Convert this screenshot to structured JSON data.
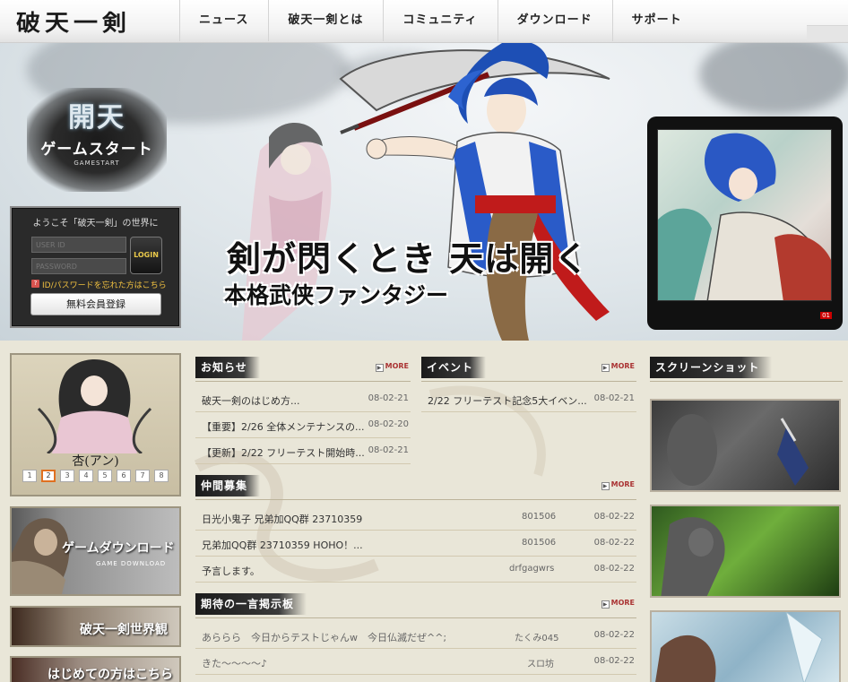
{
  "header": {
    "logo_text": "破天一剣",
    "nav": [
      "ニュース",
      "破天一剣とは",
      "コミュニティ",
      "ダウンロード",
      "サポート"
    ]
  },
  "hero": {
    "start_kanji": "開天",
    "start_jp": "ゲームスタート",
    "start_en": "GAMESTART",
    "catch1": "剣が閃くとき 天は開く",
    "catch2": "本格武侠ファンタジー",
    "thumb_number": "01"
  },
  "login": {
    "welcome": "ようこそ「破天一剣」の世界に",
    "user_placeholder": "USER ID",
    "password_placeholder": "PASSWORD",
    "login_label": "LOGIN",
    "forgot_icon": "?",
    "forgot_text": "ID/パスワードを忘れた方はこちら",
    "register_label": "無料会員登録"
  },
  "character": {
    "name": "杏(アン)",
    "pages": [
      "1",
      "2",
      "3",
      "4",
      "5",
      "6",
      "7",
      "8"
    ],
    "current_page": 2
  },
  "banners": {
    "download_jp": "ゲームダウンロード",
    "download_en": "GAME DOWNLOAD",
    "world": "破天一剣世界観",
    "first": "はじめての方はこちら"
  },
  "more_label": "MORE",
  "notice": {
    "title": "お知らせ",
    "items": [
      {
        "text": "破天一剣のはじめ方...",
        "date": "08-02-21"
      },
      {
        "text": "【重要】2/26 全体メンテナンスの...",
        "date": "08-02-20"
      },
      {
        "text": "【更新】2/22 フリーテスト開始時...",
        "date": "08-02-21"
      }
    ]
  },
  "event": {
    "title": "イベント",
    "items": [
      {
        "text": "2/22 フリーテスト記念5大イベン...",
        "date": "08-02-21"
      }
    ]
  },
  "recruit": {
    "title": "仲間募集",
    "items": [
      {
        "text": "日光小鬼子 兄弟加QQ群 23710359",
        "user": "801506",
        "date": "08-02-22"
      },
      {
        "text": "兄弟加QQ群 23710359 HOHO！...",
        "user": "801506",
        "date": "08-02-22"
      },
      {
        "text": "予言します。",
        "user": "drfgagwrs",
        "date": "08-02-22"
      }
    ]
  },
  "board": {
    "title": "期待の一言掲示板",
    "items": [
      {
        "text": "あららら　今日からテストじゃんw　今日仏滅だぜ^^;",
        "user": "たくみ045",
        "date": "08-02-22"
      },
      {
        "text": "きた～～～～♪",
        "user": "スロ坊",
        "date": "08-02-22"
      }
    ]
  },
  "screenshots": {
    "title": "スクリーンショット"
  }
}
